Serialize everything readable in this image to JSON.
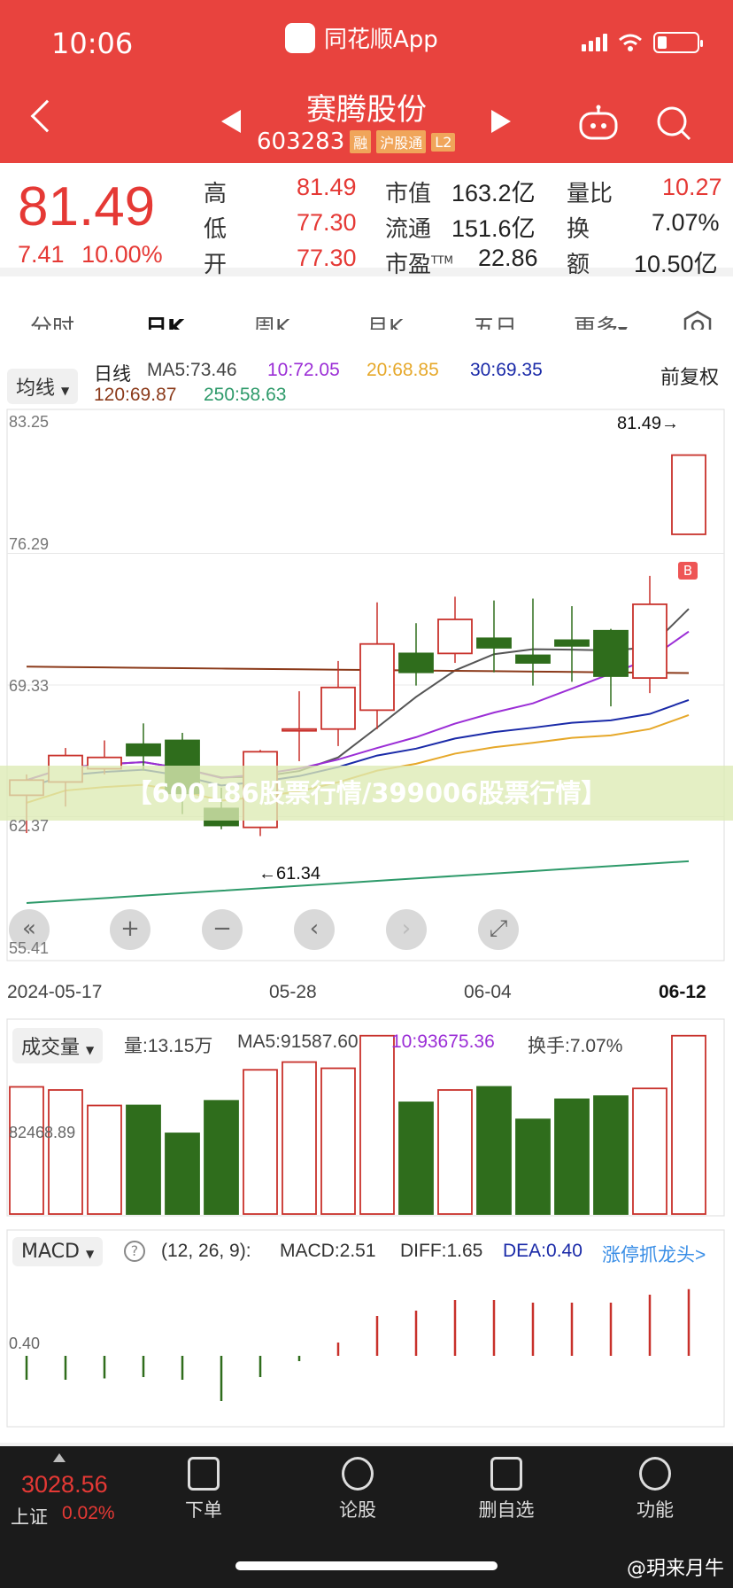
{
  "status_bar": {
    "time": "10:06",
    "app_name": "同花顺App"
  },
  "header": {
    "stock_name": "赛腾股份",
    "code": "603283",
    "tags": [
      "融",
      "沪股通",
      "L2"
    ]
  },
  "quote": {
    "price": "81.49",
    "change": "7.41",
    "change_pct": "10.00%",
    "high_label": "高",
    "high": "81.49",
    "low_label": "低",
    "low": "77.30",
    "open_label": "开",
    "open": "77.30",
    "mcap_label": "市值",
    "mcap": "163.2亿",
    "float_label": "流通",
    "float": "151.6亿",
    "pe_label": "市盈",
    "pe_sup": "TTM",
    "pe": "22.86",
    "vr_label": "量比",
    "vr": "10.27",
    "turnover_label": "换",
    "turnover": "7.07%",
    "amount_label": "额",
    "amount": "10.50亿"
  },
  "tabs": [
    "分时",
    "日K",
    "周K",
    "月K",
    "五日",
    "更多"
  ],
  "kline": {
    "ma_dropdown": "均线",
    "period_label": "日线",
    "ma5": "MA5:73.46",
    "ma10": "10:72.05",
    "ma20": "20:68.85",
    "ma30": "30:69.35",
    "ma120": "120:69.87",
    "ma250": "250:58.63",
    "adjust": "前复权",
    "high_marker": "81.49→",
    "low_marker": "←61.34",
    "buy_marker": "B",
    "banner": "【600186股票行情/399006股票行情】",
    "dates": [
      "2024-05-17",
      "05-28",
      "06-04",
      "06-12"
    ]
  },
  "volume": {
    "dropdown": "成交量",
    "vol": "量:13.15万",
    "ma5": "MA5:91587.60",
    "ma10": "10:93675.36",
    "turnover": "换手:7.07%",
    "axis_label": "82468.89"
  },
  "macd": {
    "dropdown": "MACD",
    "params": "(12, 26, 9):",
    "macd": "MACD:2.51",
    "diff": "DIFF:1.65",
    "dea": "DEA:0.40",
    "link": "涨停抓龙头>",
    "axis_label": "0.40"
  },
  "chart_data": {
    "type": "candlestick",
    "y_ticks": [
      "83.25",
      "76.29",
      "69.33",
      "62.37",
      "55.41"
    ],
    "candles": [
      {
        "o": 63.5,
        "c": 64.3,
        "h": 64.6,
        "l": 61.5
      },
      {
        "o": 64.2,
        "c": 65.6,
        "h": 66.0,
        "l": 62.9
      },
      {
        "o": 64.9,
        "c": 65.5,
        "h": 66.4,
        "l": 64.6
      },
      {
        "o": 66.2,
        "c": 65.6,
        "h": 67.3,
        "l": 64.8
      },
      {
        "o": 66.4,
        "c": 63.6,
        "h": 66.8,
        "l": 62.5
      },
      {
        "o": 62.8,
        "c": 61.9,
        "h": 63.9,
        "l": 61.7
      },
      {
        "o": 61.8,
        "c": 65.8,
        "h": 65.9,
        "l": 61.34
      },
      {
        "o": 67.0,
        "c": 67.0,
        "h": 69.0,
        "l": 65.3
      },
      {
        "o": 67.0,
        "c": 69.2,
        "h": 70.6,
        "l": 66.1
      },
      {
        "o": 68.0,
        "c": 71.5,
        "h": 73.7,
        "l": 67.0
      },
      {
        "o": 71.0,
        "c": 70.0,
        "h": 72.6,
        "l": 69.3
      },
      {
        "o": 71.0,
        "c": 72.8,
        "h": 74.0,
        "l": 70.5
      },
      {
        "o": 71.8,
        "c": 71.3,
        "h": 73.8,
        "l": 70.0
      },
      {
        "o": 70.9,
        "c": 70.5,
        "h": 73.9,
        "l": 69.3
      },
      {
        "o": 71.7,
        "c": 71.4,
        "h": 73.5,
        "l": 69.5
      },
      {
        "o": 72.2,
        "c": 69.8,
        "h": 72.3,
        "l": 68.2
      },
      {
        "o": 69.7,
        "c": 73.6,
        "h": 75.1,
        "l": 68.9
      },
      {
        "o": 77.3,
        "c": 81.49,
        "h": 81.49,
        "l": 77.3
      }
    ],
    "volume_up": [
      true,
      true,
      true,
      false,
      false,
      false,
      true,
      true,
      true,
      true,
      false,
      true,
      false,
      false,
      false,
      false,
      true,
      true
    ],
    "volume": [
      82000,
      80000,
      70000,
      70000,
      52000,
      73000,
      93000,
      98000,
      94000,
      115000,
      72000,
      80000,
      82000,
      61000,
      74000,
      76000,
      81000,
      115000
    ],
    "macd_bar": [
      -0.9,
      -0.9,
      -0.85,
      -0.8,
      -0.9,
      -1.7,
      -0.8,
      -0.2,
      0.5,
      1.5,
      1.7,
      2.1,
      2.1,
      2.0,
      2.0,
      2.0,
      2.3,
      2.51
    ]
  },
  "nav": {
    "index_value": "3028.56",
    "index_name": "上证",
    "index_pct": "0.02%",
    "items": [
      "下单",
      "论股",
      "删自选",
      "功能"
    ]
  },
  "watermark": "@玥来月牛"
}
